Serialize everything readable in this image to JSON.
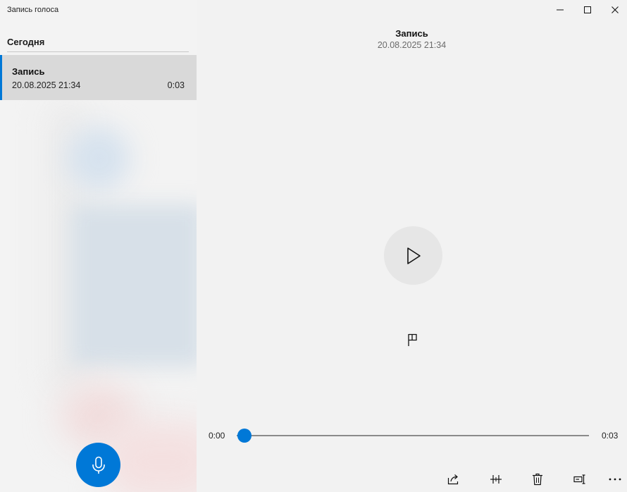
{
  "window": {
    "title": "Запись голоса",
    "controls": {
      "minimize_icon": "minimize-icon",
      "maximize_icon": "maximize-icon",
      "close_icon": "close-icon"
    }
  },
  "sidebar": {
    "section_title": "Сегодня",
    "recordings": [
      {
        "name": "Запись",
        "date": "20.08.2025 21:34",
        "duration": "0:03",
        "selected": true
      }
    ],
    "record_icon": "microphone-icon"
  },
  "player": {
    "title": "Запись",
    "date": "20.08.2025 21:34",
    "play_icon": "play-icon",
    "marker_icon": "flag-icon",
    "current_time": "0:00",
    "total_time": "0:03",
    "progress": 0
  },
  "toolbar": {
    "icons": [
      "share-icon",
      "trim-icon",
      "delete-icon",
      "rename-icon",
      "more-icon"
    ]
  },
  "colors": {
    "accent": "#0078d7",
    "background": "#f2f2f2",
    "selected_item": "#d9d9d9",
    "play_button": "#e6e6e6"
  }
}
